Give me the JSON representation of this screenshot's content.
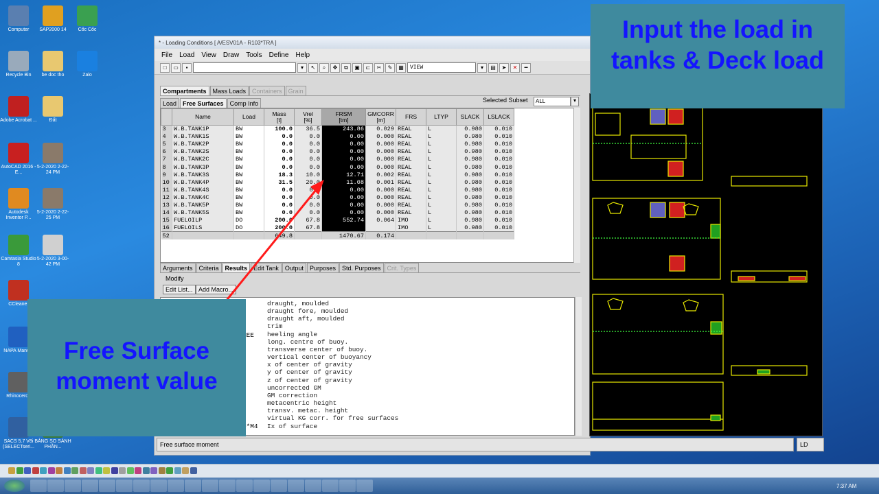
{
  "desktop_icons": [
    {
      "label": "Computer",
      "color": "#5a7fb0"
    },
    {
      "label": "SAP2000 14",
      "color": "#e0a020"
    },
    {
      "label": "Cốc Cốc",
      "color": "#3aa050"
    },
    {
      "label": "Recycle Bin",
      "color": "#9ab"
    },
    {
      "label": "be doc tho",
      "color": "#e8c870"
    },
    {
      "label": "Zalo",
      "color": "#1a80e0"
    },
    {
      "label": "Adobe Acrobat ...",
      "color": "#c02020"
    },
    {
      "label": "Đất",
      "color": "#e8c870"
    },
    {
      "label": "AutoCAD 2016 - E...",
      "color": "#c82020"
    },
    {
      "label": "5-2-2020 2-22-24 PM",
      "color": "#8a7a6a"
    },
    {
      "label": "Autodesk Inventor P...",
      "color": "#e08a20"
    },
    {
      "label": "5-2-2020 2-22-25 PM",
      "color": "#8a7a6a"
    },
    {
      "label": "Camtasia Studio 8",
      "color": "#3a9a3a"
    },
    {
      "label": "5-2-2020 3-00-42 PM",
      "color": "#d0d0d0"
    },
    {
      "label": "CCleaner",
      "color": "#c03020"
    },
    {
      "label": "NAPA Manu...",
      "color": "#2060c0"
    },
    {
      "label": "Rhinoceros",
      "color": "#606060"
    },
    {
      "label": "SACS 5.7 V8i (SELECTseri...",
      "color": "#3060a0"
    },
    {
      "label": "BẢNG SO SÁNH PHẦN...",
      "color": "#3a7a3a"
    }
  ],
  "window": {
    "title": "* - Loading Conditions [ A/ESV01A - R103*TRA ]",
    "menu": [
      "File",
      "Load",
      "View",
      "Draw",
      "Tools",
      "Define",
      "Help"
    ],
    "toolbar_combo2": "VIEW"
  },
  "top_tabs": [
    {
      "label": "Compartments",
      "state": "active"
    },
    {
      "label": "Mass Loads",
      "state": "normal"
    },
    {
      "label": "Containers",
      "state": "disabled"
    },
    {
      "label": "Grain",
      "state": "disabled"
    }
  ],
  "sub_tabs": [
    {
      "label": "Load",
      "state": "normal"
    },
    {
      "label": "Free Surfaces",
      "state": "active"
    },
    {
      "label": "Comp Info",
      "state": "normal"
    }
  ],
  "subset": {
    "label": "Selected Subset",
    "value": "ALL"
  },
  "columns": [
    "Name",
    "Load",
    "Mass\n[t]",
    "Vrel\n[%]",
    "FRSM\n[tm]",
    "GMCORR\n[m]",
    "FRS",
    "LTYP",
    "SLACK",
    "LSLACK"
  ],
  "rows": [
    {
      "n": "3",
      "name": "W.B.TANK1P",
      "load": "BW",
      "mass": "100.0",
      "vrel": "36.5",
      "frsm": "243.86",
      "gm": "0.029",
      "frs": "REAL",
      "ltyp": "L",
      "slack": "0.980",
      "lslack": "0.010"
    },
    {
      "n": "4",
      "name": "W.B.TANK1S",
      "load": "BW",
      "mass": "0.0",
      "vrel": "0.0",
      "frsm": "0.00",
      "gm": "0.000",
      "frs": "REAL",
      "ltyp": "L",
      "slack": "0.980",
      "lslack": "0.010"
    },
    {
      "n": "5",
      "name": "W.B.TANK2P",
      "load": "BW",
      "mass": "0.0",
      "vrel": "0.0",
      "frsm": "0.00",
      "gm": "0.000",
      "frs": "REAL",
      "ltyp": "L",
      "slack": "0.980",
      "lslack": "0.010"
    },
    {
      "n": "6",
      "name": "W.B.TANK2S",
      "load": "BW",
      "mass": "0.0",
      "vrel": "0.0",
      "frsm": "0.00",
      "gm": "0.000",
      "frs": "REAL",
      "ltyp": "L",
      "slack": "0.980",
      "lslack": "0.010"
    },
    {
      "n": "7",
      "name": "W.B.TANK2C",
      "load": "BW",
      "mass": "0.0",
      "vrel": "0.0",
      "frsm": "0.00",
      "gm": "0.000",
      "frs": "REAL",
      "ltyp": "L",
      "slack": "0.980",
      "lslack": "0.010"
    },
    {
      "n": "8",
      "name": "W.B.TANK3P",
      "load": "BW",
      "mass": "0.0",
      "vrel": "0.0",
      "frsm": "0.00",
      "gm": "0.000",
      "frs": "REAL",
      "ltyp": "L",
      "slack": "0.980",
      "lslack": "0.010"
    },
    {
      "n": "9",
      "name": "W.B.TANK3S",
      "load": "BW",
      "mass": "18.3",
      "vrel": "10.0",
      "frsm": "12.71",
      "gm": "0.002",
      "frs": "REAL",
      "ltyp": "L",
      "slack": "0.980",
      "lslack": "0.010"
    },
    {
      "n": "10",
      "name": "W.B.TANK4P",
      "load": "BW",
      "mass": "31.5",
      "vrel": "20.0",
      "frsm": "11.08",
      "gm": "0.001",
      "frs": "REAL",
      "ltyp": "L",
      "slack": "0.980",
      "lslack": "0.010"
    },
    {
      "n": "11",
      "name": "W.B.TANK4S",
      "load": "BW",
      "mass": "0.0",
      "vrel": "0.0",
      "frsm": "0.00",
      "gm": "0.000",
      "frs": "REAL",
      "ltyp": "L",
      "slack": "0.980",
      "lslack": "0.010"
    },
    {
      "n": "12",
      "name": "W.B.TANK4C",
      "load": "BW",
      "mass": "0.0",
      "vrel": "0.0",
      "frsm": "0.00",
      "gm": "0.000",
      "frs": "REAL",
      "ltyp": "L",
      "slack": "0.980",
      "lslack": "0.010"
    },
    {
      "n": "13",
      "name": "W.B.TANK5P",
      "load": "BW",
      "mass": "0.0",
      "vrel": "0.0",
      "frsm": "0.00",
      "gm": "0.000",
      "frs": "REAL",
      "ltyp": "L",
      "slack": "0.980",
      "lslack": "0.010"
    },
    {
      "n": "14",
      "name": "W.B.TANK5S",
      "load": "BW",
      "mass": "0.0",
      "vrel": "0.0",
      "frsm": "0.00",
      "gm": "0.000",
      "frs": "REAL",
      "ltyp": "L",
      "slack": "0.980",
      "lslack": "0.010"
    },
    {
      "n": "15",
      "name": "FUELOILP",
      "load": "DO",
      "mass": "200.0",
      "vrel": "67.8",
      "frsm": "552.74",
      "gm": "0.064",
      "frs": "IMO",
      "ltyp": "L",
      "slack": "0.980",
      "lslack": "0.010"
    },
    {
      "n": "16",
      "name": "FUELOILS",
      "load": "DO",
      "mass": "200.0",
      "vrel": "67.8",
      "frsm": "",
      "gm": "",
      "frs": "IMO",
      "ltyp": "L",
      "slack": "0.980",
      "lslack": "0.010"
    }
  ],
  "totals": {
    "n": "52",
    "mass": "649.8",
    "frsm": "1470.67",
    "gm": "0.174"
  },
  "bottom_tabs": [
    {
      "label": "Arguments",
      "state": "normal"
    },
    {
      "label": "Criteria",
      "state": "normal"
    },
    {
      "label": "Results",
      "state": "active"
    },
    {
      "label": "Edit Tank",
      "state": "normal"
    },
    {
      "label": "Output",
      "state": "normal"
    },
    {
      "label": "Purposes",
      "state": "normal"
    },
    {
      "label": "Std. Purposes",
      "state": "normal"
    },
    {
      "label": "Crit. Types",
      "state": "disabled"
    }
  ],
  "modify": {
    "label": "Modify",
    "edit_list": "Edit List...",
    "add_macro": "Add Macro..."
  },
  "results_lines": [
    "draught, moulded",
    "draught fore, moulded",
    "draught aft, moulded",
    "trim",
    "heeling angle",
    "long. centre of buoy.",
    "transverse center of buoy.",
    "vertical center of buoyancy",
    "x of center of gravity",
    "y of center of gravity",
    "z of center of gravity",
    "uncorrected GM",
    "GM correction",
    "metacentric height",
    "transv. metac. height",
    "virtual KG corr. for free surfaces",
    "Ix of surface"
  ],
  "results_prefix_ree": "REE",
  "results_prefix_m4": "D*M4",
  "status_text": "Free surface moment",
  "status_right": "LD",
  "callouts": {
    "right": "Input the load in tanks & Deck load",
    "left": "Free Surface moment value"
  },
  "clock": "7:37 AM",
  "colors": {
    "callout_bg": "#3f8a9e",
    "callout_text": "#1414ff",
    "arrow": "#ff1a1a",
    "drawing_lines": "#e8e800"
  }
}
